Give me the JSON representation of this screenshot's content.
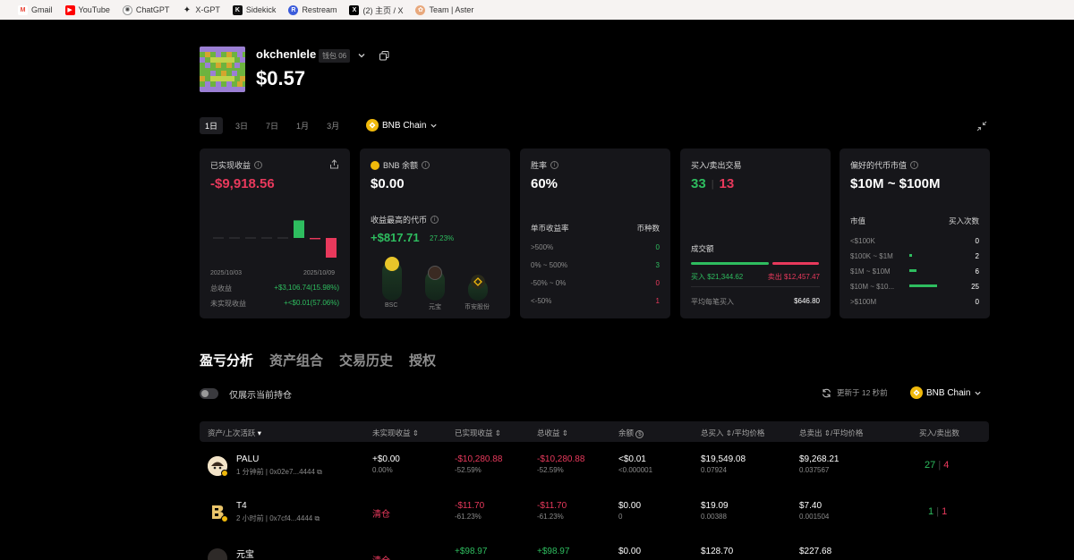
{
  "bookmarks": [
    {
      "label": "Gmail",
      "icon": "gmail-icon",
      "color": "#ea4335",
      "glyph": "M"
    },
    {
      "label": "YouTube",
      "icon": "youtube-icon",
      "color": "#ff0000",
      "glyph": "▶"
    },
    {
      "label": "ChatGPT",
      "icon": "chatgpt-icon",
      "color": "#444444",
      "glyph": "✺"
    },
    {
      "label": "X-GPT",
      "icon": "jordan-icon",
      "color": "#222222",
      "glyph": "✦"
    },
    {
      "label": "Sidekick",
      "icon": "sidekick-icon",
      "color": "#111111",
      "glyph": "K"
    },
    {
      "label": "Restream",
      "icon": "restream-icon",
      "color": "#3b5bdb",
      "glyph": "R"
    },
    {
      "label": "(2) 主页 / X",
      "icon": "x-icon",
      "color": "#000000",
      "glyph": "X"
    },
    {
      "label": "Team | Aster",
      "icon": "aster-icon",
      "color": "#e8a87c",
      "glyph": "✿"
    }
  ],
  "profile": {
    "name": "okchenlele",
    "wallet_tag": "钱包 06",
    "balance": "$0.57"
  },
  "periods": [
    "1日",
    "3日",
    "7日",
    "1月",
    "3月"
  ],
  "chain": "BNB Chain",
  "cards": {
    "realized": {
      "title": "已实现收益",
      "value": "-$9,918.56",
      "date_start": "2025/10/03",
      "date_end": "2025/10/09",
      "total_label": "总收益",
      "total_value": "+$3,106.74(15.98%)",
      "unrealized_label": "未实现收益",
      "unrealized_value": "+<$0.01(57.06%)"
    },
    "bnb": {
      "title": "BNB 余额",
      "value": "$0.00",
      "top_title": "收益最高的代币",
      "top_value": "+$817.71",
      "top_pct": "27.23%",
      "tokens": [
        "BSC",
        "元宝",
        "币安股份"
      ]
    },
    "winrate": {
      "title": "胜率",
      "value": "60%",
      "col1": "单币收益率",
      "col2": "币种数",
      "rows": [
        {
          "label": ">500%",
          "count": "0"
        },
        {
          "label": "0% ~ 500%",
          "count": "3"
        },
        {
          "label": "-50% ~ 0%",
          "count": "0"
        },
        {
          "label": "<-50%",
          "count": "1"
        }
      ]
    },
    "trades": {
      "title": "买入/卖出交易",
      "buys": "33",
      "sells": "13",
      "volume_label": "成交额",
      "buy_label": "买入 $21,344.62",
      "sell_label": "卖出 $12,457.47",
      "avg_label": "平均每笔买入",
      "avg_value": "$646.80"
    },
    "mcap": {
      "title": "偏好的代币市值",
      "value": "$10M ~ $100M",
      "col1": "市值",
      "col2": "买入次数",
      "rows": [
        {
          "label": "<$100K",
          "count": "0"
        },
        {
          "label": "$100K ~ $1M",
          "count": "2"
        },
        {
          "label": "$1M ~ $10M",
          "count": "6"
        },
        {
          "label": "$10M ~ $10...",
          "count": "25"
        },
        {
          "label": ">$100M",
          "count": "0"
        }
      ]
    }
  },
  "bar_chart": {
    "values": [
      0,
      0,
      0,
      0,
      0,
      820,
      -60,
      -920
    ]
  },
  "section_tabs": [
    "盈亏分析",
    "资产组合",
    "交易历史",
    "授权"
  ],
  "toggle_label": "仅展示当前持仓",
  "updated": "更新于 12 秒前",
  "table": {
    "headers": [
      "资产/上次活跃",
      "未实现收益",
      "已实现收益",
      "总收益",
      "余额",
      "总买入",
      "/平均价格",
      "总卖出",
      "/平均价格",
      "买入/卖出数"
    ],
    "rows": [
      {
        "name": "PALU",
        "meta": "1 分钟前 | 0x02e7...4444",
        "unrealized": "+$0.00",
        "unrealized_sub": "0.00%",
        "realized": "-$10,280.88",
        "realized_sub": "-52.59%",
        "total": "-$10,280.88",
        "total_sub": "-52.59%",
        "balance": "<$0.01",
        "balance_sub": "<0.000001",
        "bought": "$19,549.08",
        "bought_sub": "0.07924",
        "sold": "$9,268.21",
        "sold_sub": "0.037567",
        "buys": "27",
        "sells": "4"
      },
      {
        "name": "T4",
        "meta": "2 小时前 | 0x7cf4...4444",
        "unrealized": "清仓",
        "unrealized_sub": "",
        "realized": "-$11.70",
        "realized_sub": "-61.23%",
        "total": "-$11.70",
        "total_sub": "-61.23%",
        "balance": "$0.00",
        "balance_sub": "0",
        "bought": "$19.09",
        "bought_sub": "0.00388",
        "sold": "$7.40",
        "sold_sub": "0.001504",
        "buys": "1",
        "sells": "1"
      },
      {
        "name": "元宝",
        "meta": "",
        "unrealized": "清仓",
        "unrealized_sub": "",
        "realized": "+$98.97",
        "realized_sub": "",
        "total": "+$98.97",
        "total_sub": "",
        "balance": "$0.00",
        "balance_sub": "",
        "bought": "$128.70",
        "bought_sub": "",
        "sold": "$227.68",
        "sold_sub": "",
        "buys": "",
        "sells": ""
      }
    ]
  }
}
